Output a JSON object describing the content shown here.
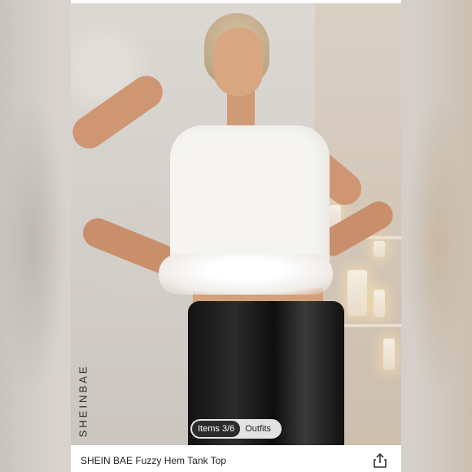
{
  "brand": {
    "name": "SHEINBAE"
  },
  "gallery": {
    "tabs": [
      {
        "label": "Items 3/6",
        "active": true
      },
      {
        "label": "Outfits",
        "active": false
      }
    ]
  },
  "product": {
    "title": "SHEIN BAE Fuzzy Hem Tank Top"
  },
  "actions": {
    "share_icon": "share-icon"
  },
  "colors": {
    "pill_active_bg": "#2b2b2b",
    "card_bg": "#ffffff"
  }
}
